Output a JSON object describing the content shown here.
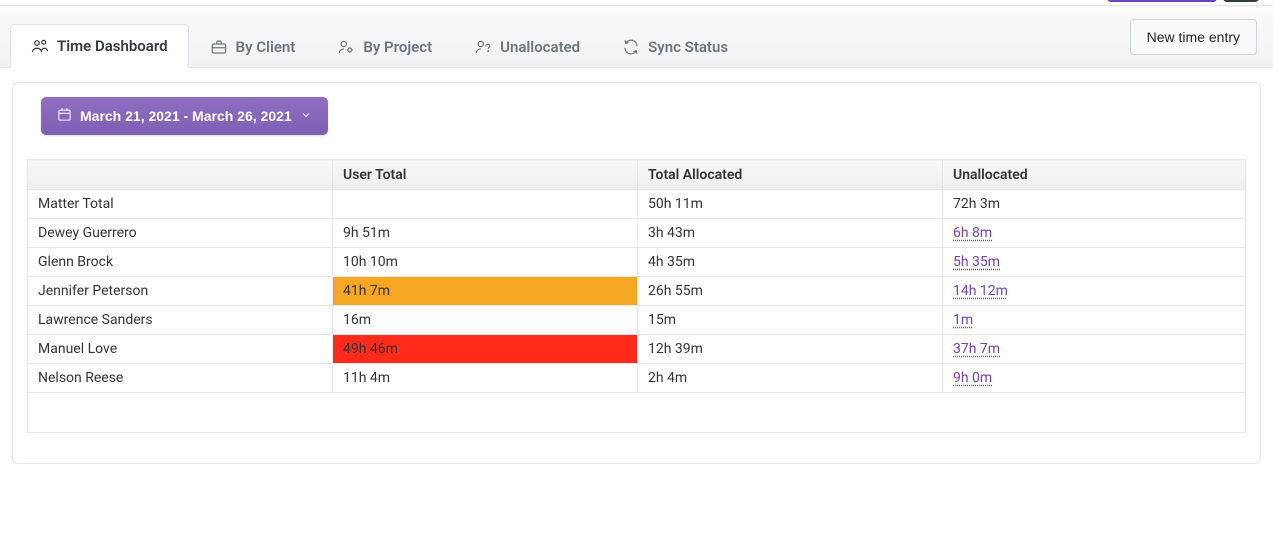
{
  "tabs": [
    {
      "label": "Time Dashboard",
      "icon": "users-icon",
      "active": true
    },
    {
      "label": "By Client",
      "icon": "briefcase-icon",
      "active": false
    },
    {
      "label": "By Project",
      "icon": "user-gear-icon",
      "active": false
    },
    {
      "label": "Unallocated",
      "icon": "user-question-icon",
      "active": false
    },
    {
      "label": "Sync Status",
      "icon": "refresh-icon",
      "active": false
    }
  ],
  "buttons": {
    "new_time_entry": "New time entry"
  },
  "date_range": "March 21, 2021 - March 26, 2021",
  "table": {
    "headers": {
      "name": "",
      "user_total": "User Total",
      "total_allocated": "Total Allocated",
      "unallocated": "Unallocated"
    },
    "rows": [
      {
        "name": "Matter Total",
        "user_total": "",
        "total_allocated": "50h 11m",
        "unallocated": "72h 3m",
        "unallocated_link": false,
        "highlight": null
      },
      {
        "name": "Dewey Guerrero",
        "user_total": "9h 51m",
        "total_allocated": "3h 43m",
        "unallocated": "6h 8m",
        "unallocated_link": true,
        "highlight": null
      },
      {
        "name": "Glenn Brock",
        "user_total": "10h 10m",
        "total_allocated": "4h 35m",
        "unallocated": "5h 35m",
        "unallocated_link": true,
        "highlight": null
      },
      {
        "name": "Jennifer Peterson",
        "user_total": "41h 7m",
        "total_allocated": "26h 55m",
        "unallocated": "14h 12m",
        "unallocated_link": true,
        "highlight": "orange"
      },
      {
        "name": "Lawrence Sanders",
        "user_total": "16m",
        "total_allocated": "15m",
        "unallocated": "1m",
        "unallocated_link": true,
        "highlight": null
      },
      {
        "name": "Manuel Love",
        "user_total": "49h 46m",
        "total_allocated": "12h 39m",
        "unallocated": "37h 7m",
        "unallocated_link": true,
        "highlight": "red"
      },
      {
        "name": "Nelson Reese",
        "user_total": "11h 4m",
        "total_allocated": "2h 4m",
        "unallocated": "9h 0m",
        "unallocated_link": true,
        "highlight": null
      }
    ]
  }
}
